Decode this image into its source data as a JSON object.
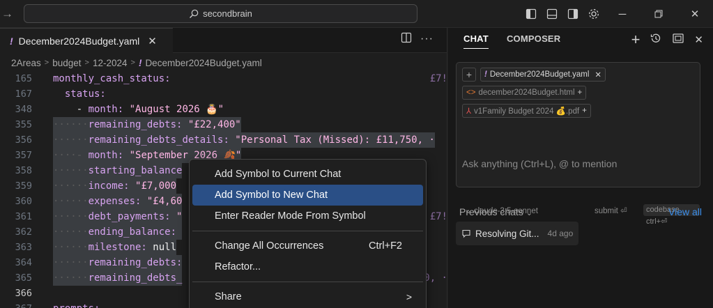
{
  "titlebar": {
    "search_label": "secondbrain"
  },
  "editor": {
    "tab": {
      "bang": "!",
      "name": "December2024Budget.yaml"
    },
    "breadcrumb": [
      "2Areas",
      "budget",
      "12-2024",
      "December2024Budget.yaml"
    ],
    "breadcrumb_bang": "!",
    "lines": [
      {
        "num": "165",
        "indent": "",
        "key": "monthly_cash_status:",
        "val": "",
        "peek": "£7!",
        "sel": false
      },
      {
        "num": "167",
        "indent": "  ",
        "key": "status:",
        "val": "",
        "sel": false
      },
      {
        "num": "348",
        "indent": "    - ",
        "key": "month: ",
        "val": "\"August 2026 🎂\"",
        "sel": false
      },
      {
        "num": "355",
        "indent": "······",
        "key": "remaining_debts: ",
        "val": "\"£22,400\"",
        "sel": true
      },
      {
        "num": "356",
        "indent": "······",
        "key": "remaining_debts_details: ",
        "val": "\"Personal Tax (Missed): £11,750, ·",
        "sel": true
      },
      {
        "num": "357",
        "indent": "····- ",
        "key": "month: ",
        "val": "\"September 2026 🍂\"",
        "sel": true
      },
      {
        "num": "358",
        "indent": "······",
        "key": "starting_balance",
        "val": "",
        "sel": true
      },
      {
        "num": "359",
        "indent": "······",
        "key": "income: ",
        "val": "\"£7,000",
        "sel": true
      },
      {
        "num": "360",
        "indent": "······",
        "key": "expenses: ",
        "val": "\"£4,60",
        "sel": true
      },
      {
        "num": "361",
        "indent": "······",
        "key": "debt_payments: ",
        "val": "\"",
        "peek": "£7!",
        "sel": true
      },
      {
        "num": "362",
        "indent": "······",
        "key": "ending_balance: ",
        "val": "",
        "sel": true
      },
      {
        "num": "363",
        "indent": "······",
        "key": "milestone: ",
        "val": "null",
        "sel": true
      },
      {
        "num": "364",
        "indent": "······",
        "key": "remaining_debts:",
        "val": "",
        "sel": true
      },
      {
        "num": "365",
        "indent": "······",
        "key": "remaining_debts_",
        "val": "",
        "peek": "00, ·",
        "sel": true
      },
      {
        "num": "366",
        "indent": "",
        "key": "",
        "val": "",
        "sel": false,
        "active": true
      },
      {
        "num": "367",
        "indent": "",
        "key": "prompts:",
        "val": "",
        "sel": false
      }
    ]
  },
  "context_menu": {
    "items": [
      {
        "label": "Add Symbol to Current Chat"
      },
      {
        "label": "Add Symbol to New Chat",
        "highlighted": true
      },
      {
        "label": "Enter Reader Mode From Symbol"
      },
      {
        "label": "Change All Occurrences",
        "shortcut": "Ctrl+F2"
      },
      {
        "label": "Refactor..."
      },
      {
        "label": "Share"
      }
    ]
  },
  "chat": {
    "tabs": [
      "CHAT",
      "COMPOSER"
    ],
    "context_pills": {
      "file_yaml": "December2024Budget.yaml",
      "file_html": "december2024Budget.html",
      "file_pdf": "v1Family Budget 2024 💰.pdf"
    },
    "placeholder": "Ask anything (Ctrl+L), @ to mention",
    "model": "claude-3.5-sonnet",
    "submit": "submit",
    "codebase": "codebase ctrl+",
    "previous_chats_label": "Previous chats",
    "view_all": "View all",
    "previous": [
      {
        "title": "Resolving Git...",
        "ago": "4d ago"
      }
    ]
  }
}
